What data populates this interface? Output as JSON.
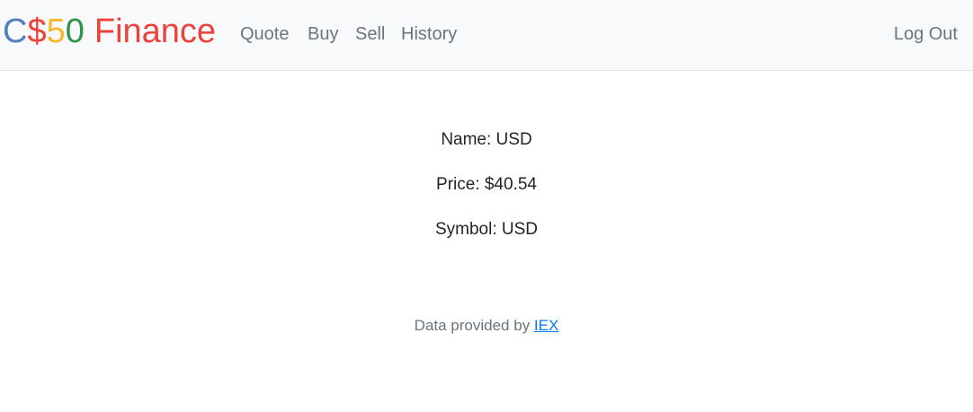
{
  "brand": {
    "parts": [
      {
        "text": "C",
        "color": "#537fbe"
      },
      {
        "text": "$",
        "color": "#ea433b"
      },
      {
        "text": "5",
        "color": "#f5b82e"
      },
      {
        "text": "0",
        "color": "#2e944b"
      },
      {
        "text": "Finance",
        "color": "#ea433b"
      }
    ]
  },
  "nav": {
    "quote": "Quote",
    "buy": "Buy",
    "sell": "Sell",
    "history": "History",
    "logout": "Log Out"
  },
  "quote": {
    "name_line": "Name: USD",
    "price_line": "Price: $40.54",
    "symbol_line": "Symbol: USD"
  },
  "footer": {
    "prefix": "Data provided by ",
    "link_text": "IEX"
  },
  "colors": {
    "navbar_bg": "#f8f9fa",
    "nav_text": "#6c757d",
    "link": "#007bff"
  }
}
